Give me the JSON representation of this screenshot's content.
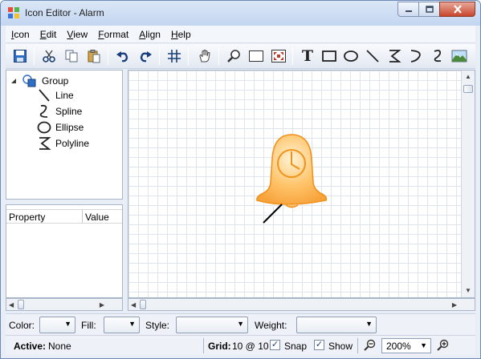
{
  "window": {
    "title": "Icon Editor - Alarm",
    "controls": [
      "minimize-icon",
      "maximize-icon",
      "close-icon"
    ]
  },
  "menu": {
    "items": [
      {
        "mnemonic": "I",
        "rest": "con"
      },
      {
        "mnemonic": "E",
        "rest": "dit"
      },
      {
        "mnemonic": "V",
        "rest": "iew"
      },
      {
        "mnemonic": "F",
        "rest": "ormat"
      },
      {
        "mnemonic": "A",
        "rest": "lign"
      },
      {
        "mnemonic": "H",
        "rest": "elp"
      }
    ]
  },
  "toolbar": {
    "icons": [
      "save-icon",
      "cut-icon",
      "copy-icon",
      "paste-icon",
      "undo-icon",
      "redo-icon",
      "grid-icon",
      "pan-hand-icon",
      "zoom-icon",
      "rectangle-select-icon",
      "fit-icon",
      "text-tool-icon",
      "rectangle-tool-icon",
      "ellipse-tool-icon",
      "line-tool-icon",
      "polyline-tool-icon",
      "curve-tool-icon",
      "spline-tool-icon",
      "image-tool-icon"
    ],
    "text_tool_glyph": "T"
  },
  "tree": {
    "root": "Group",
    "children": [
      "Line",
      "Spline",
      "Ellipse",
      "Polyline"
    ]
  },
  "properties": {
    "col_property": "Property",
    "col_value": "Value"
  },
  "format": {
    "color_label": "Color:",
    "fill_label": "Fill:",
    "style_label": "Style:",
    "weight_label": "Weight:"
  },
  "status": {
    "active_label": "Active:",
    "active_value": "None",
    "grid_label": "Grid:",
    "grid_value": "10 @ 10",
    "snap_label": "Snap",
    "snap_checked": "✓",
    "show_label": "Show",
    "show_checked": "✓",
    "zoom_value": "200%"
  },
  "colors": {
    "bell_fill": "#ffc46a",
    "bell_stroke": "#f0921c",
    "accent": "#1a3f7a"
  }
}
